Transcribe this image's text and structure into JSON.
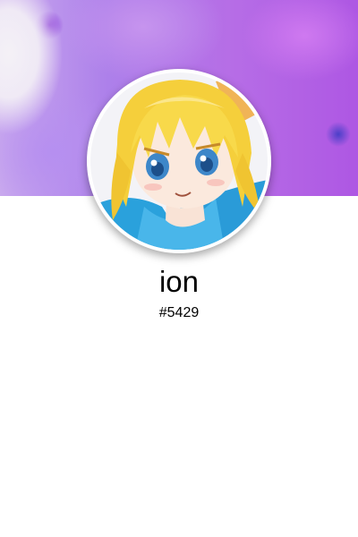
{
  "profile": {
    "username": "ion",
    "discriminator": "#5429",
    "avatar_icon": "anime-girl-avatar",
    "banner_colors": [
      "#c9a9ee",
      "#ad80ea",
      "#b66de6",
      "#ae57e3"
    ]
  }
}
